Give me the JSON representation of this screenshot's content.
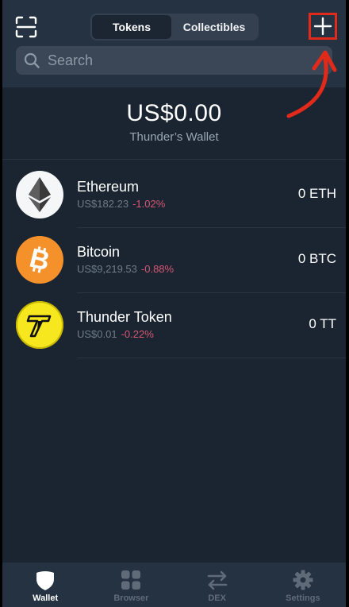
{
  "header": {
    "segments": [
      "Tokens",
      "Collectibles"
    ],
    "active_segment": "Tokens",
    "search_placeholder": "Search",
    "add_icon": "plus-icon",
    "scan_icon": "scan-icon",
    "highlight_color": "#e22a1a"
  },
  "balance": {
    "amount": "US$0.00",
    "wallet_name": "Thunder’s Wallet"
  },
  "tokens": [
    {
      "name": "Ethereum",
      "price": "US$182.23",
      "change": "-1.02%",
      "balance": "0 ETH",
      "icon": "ethereum-icon"
    },
    {
      "name": "Bitcoin",
      "price": "US$9,219.53",
      "change": "-0.88%",
      "balance": "0 BTC",
      "icon": "bitcoin-icon"
    },
    {
      "name": "Thunder Token",
      "price": "US$0.01",
      "change": "-0.22%",
      "balance": "0 TT",
      "icon": "thunder-token-icon"
    }
  ],
  "tabbar": {
    "tabs": [
      {
        "label": "Wallet",
        "icon": "shield-icon",
        "active": true
      },
      {
        "label": "Browser",
        "icon": "grid-icon",
        "active": false
      },
      {
        "label": "DEX",
        "icon": "swap-icon",
        "active": false
      },
      {
        "label": "Settings",
        "icon": "gear-icon",
        "active": false
      }
    ]
  }
}
